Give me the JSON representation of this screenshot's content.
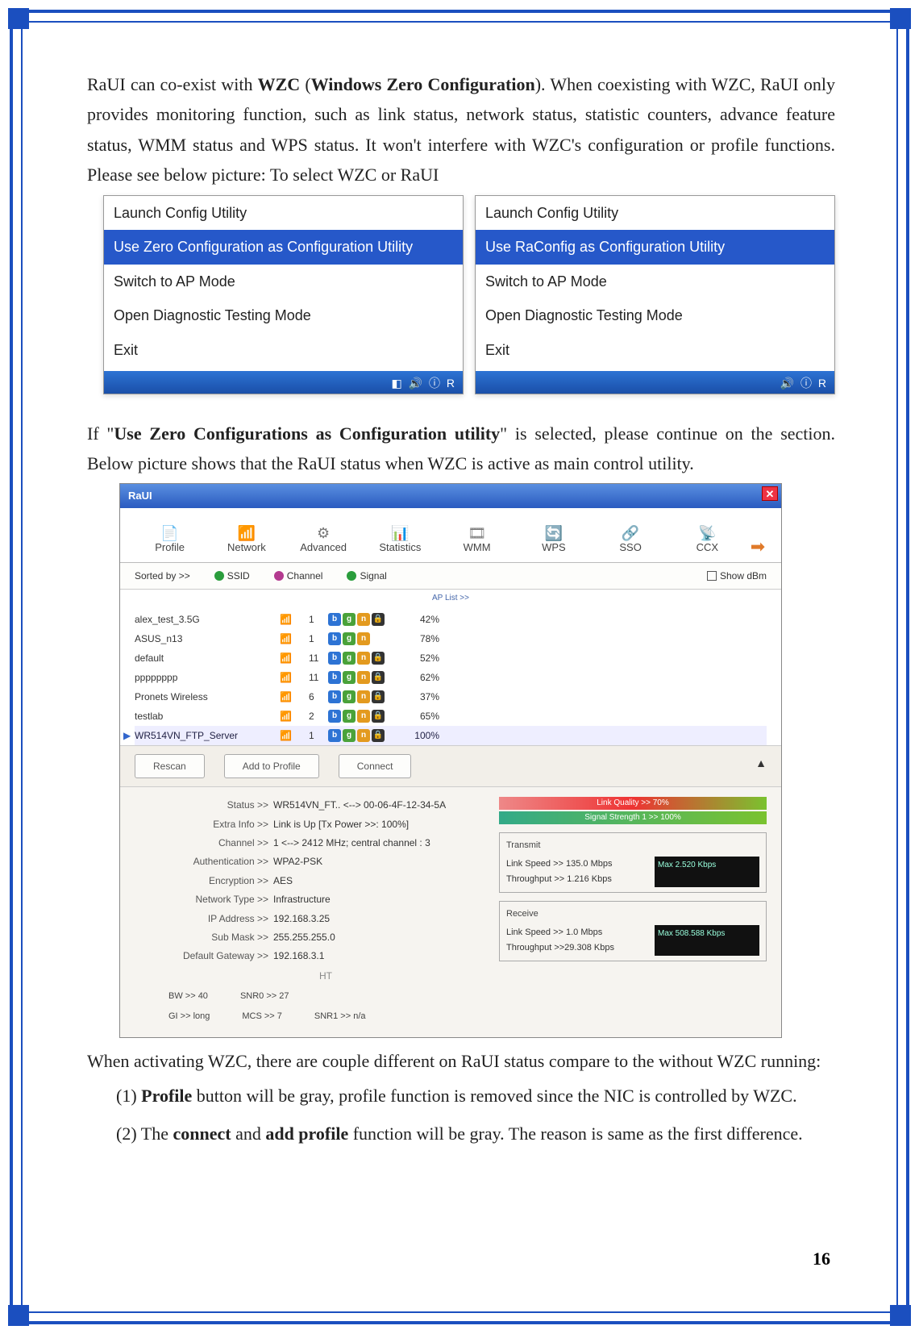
{
  "page_number": "16",
  "para1_a": "RaUI can co-exist with ",
  "para1_b": "WZC",
  "para1_c": " (",
  "para1_d": "Windows Zero Configuration",
  "para1_e": "). When coexisting with WZC, RaUI only provides monitoring function, such as link status, network status, statistic counters, advance feature status, WMM status and WPS status. It won't interfere with WZC's configuration or profile functions. Please see below picture: To select WZC or RaUI",
  "menu_left": {
    "items": [
      "Launch Config Utility",
      "Use Zero Configuration as Configuration Utility",
      "Switch to AP Mode",
      "Open Diagnostic Testing Mode",
      "Exit"
    ],
    "selected": 1
  },
  "menu_right": {
    "items": [
      "Launch Config Utility",
      "Use RaConfig as Configuration Utility",
      "Switch to AP Mode",
      "Open Diagnostic Testing Mode",
      "Exit"
    ],
    "selected": 1
  },
  "para2_a": "If \"",
  "para2_b": "Use Zero Configurations as Configuration utility",
  "para2_c": "\" is selected, please continue on the section. Below picture shows that the RaUI status when WZC is active as main control utility.",
  "raui": {
    "title": "RaUI",
    "tabs": [
      "Profile",
      "Network",
      "Advanced",
      "Statistics",
      "WMM",
      "WPS",
      "SSO",
      "CCX"
    ],
    "sort_label": "Sorted by >>",
    "sort_ssid": "SSID",
    "sort_channel": "Channel",
    "sort_signal": "Signal",
    "aplist_label": "AP List >>",
    "show_dbm": "Show dBm",
    "networks": [
      {
        "name": "alex_test_3.5G",
        "ch": "1",
        "badges": [
          "b",
          "g",
          "n",
          "•"
        ],
        "pct": "42%",
        "bar": 42
      },
      {
        "name": "ASUS_n13",
        "ch": "1",
        "badges": [
          "b",
          "g",
          "n"
        ],
        "pct": "78%",
        "bar": 78
      },
      {
        "name": "default",
        "ch": "11",
        "badges": [
          "b",
          "g",
          "n",
          "k"
        ],
        "pct": "52%",
        "bar": 52
      },
      {
        "name": "pppppppp",
        "ch": "11",
        "badges": [
          "b",
          "g",
          "n",
          "k"
        ],
        "pct": "62%",
        "bar": 62
      },
      {
        "name": "Pronets Wireless",
        "ch": "6",
        "badges": [
          "b",
          "g",
          "n",
          "•"
        ],
        "pct": "37%",
        "bar": 37
      },
      {
        "name": "testlab",
        "ch": "2",
        "badges": [
          "b",
          "g",
          "n",
          "•"
        ],
        "pct": "65%",
        "bar": 65
      },
      {
        "name": "WR514VN_FTP_Server",
        "ch": "1",
        "badges": [
          "b",
          "g",
          "n",
          "k"
        ],
        "pct": "100%",
        "bar": 100
      }
    ],
    "buttons": [
      "Rescan",
      "Add to Profile",
      "Connect"
    ],
    "details": {
      "Status": "WR514VN_FT.. <--> 00-06-4F-12-34-5A",
      "Extra_Info": "Link is Up [Tx Power >>: 100%]",
      "Channel": "1 <--> 2412 MHz; central channel : 3",
      "Authentication": "WPA2-PSK",
      "Encryption": "AES",
      "Network_Type": "Infrastructure",
      "IP_Address": "192.168.3.25",
      "Sub_Mask": "255.255.255.0",
      "Default_Gateway": "192.168.3.1"
    },
    "ht_label": "HT",
    "ht": {
      "BW": "40",
      "GI": "long",
      "MCS": "7",
      "SNR0": "27",
      "SNR1": "n/a"
    },
    "quality": {
      "link": "Link Quality >> 70%",
      "signal": "Signal Strength 1 >> 100%"
    },
    "transmit": {
      "title": "Transmit",
      "ls": "Link Speed >>  135.0 Mbps",
      "tp": "Throughput >> 1.216 Kbps",
      "spark": "Max\n2.520\nKbps"
    },
    "receive": {
      "title": "Receive",
      "ls": "Link Speed >> 1.0 Mbps",
      "tp": "Throughput >>29.308 Kbps",
      "spark": "Max\n508.588\nKbps"
    }
  },
  "para3": "When activating WZC, there are couple different on RaUI status compare to the without WZC running:",
  "diff1_a": "Profile",
  "diff1_b": " button will be gray, profile function is removed since the NIC is controlled by WZC.",
  "diff2_a": "The ",
  "diff2_b": "connect",
  "diff2_c": " and ",
  "diff2_d": "add profile",
  "diff2_e": " function will be gray. The reason is same as the first difference."
}
